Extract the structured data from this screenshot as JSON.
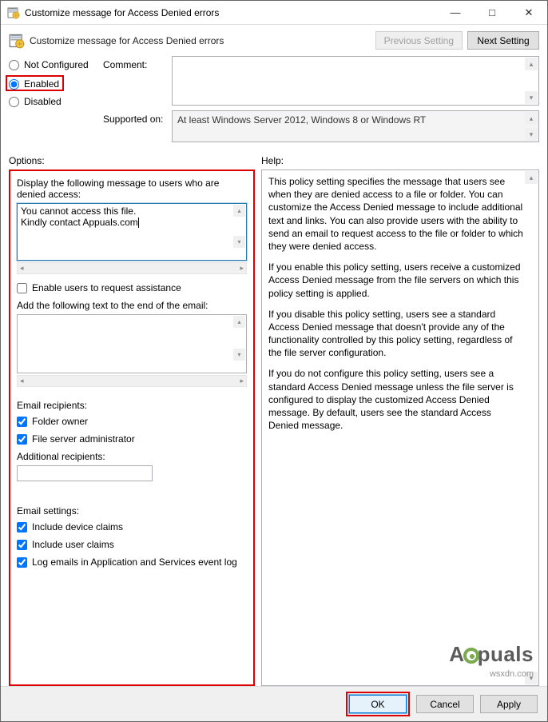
{
  "window": {
    "title": "Customize message for Access Denied errors"
  },
  "header": {
    "title": "Customize message for Access Denied errors",
    "prev_btn": "Previous Setting",
    "next_btn": "Next Setting"
  },
  "state": {
    "not_configured": "Not Configured",
    "enabled": "Enabled",
    "disabled": "Disabled",
    "selected": "enabled"
  },
  "meta": {
    "comment_label": "Comment:",
    "comment_value": "",
    "supported_label": "Supported on:",
    "supported_value": "At least Windows Server 2012, Windows 8 or Windows RT"
  },
  "sections": {
    "options_label": "Options:",
    "help_label": "Help:"
  },
  "options": {
    "display_msg_label": "Display the following message to users who are denied access:",
    "display_msg_value": "You cannot access this file.\nKindly contact Appuals.com",
    "enable_request_label": "Enable users to request assistance",
    "enable_request_checked": false,
    "email_text_label": "Add the following text to the end of the email:",
    "email_text_value": "",
    "recipients_label": "Email recipients:",
    "folder_owner_label": "Folder owner",
    "folder_owner_checked": true,
    "file_admin_label": "File server administrator",
    "file_admin_checked": true,
    "additional_label": "Additional recipients:",
    "additional_value": "",
    "settings_label": "Email settings:",
    "device_claims_label": "Include device claims",
    "device_claims_checked": true,
    "user_claims_label": "Include user claims",
    "user_claims_checked": true,
    "log_emails_label": "Log emails in Application and Services event log",
    "log_emails_checked": true
  },
  "help": {
    "p1": "This policy setting specifies the message that users see when they are denied access to a file or folder. You can customize the Access Denied message to include additional text and links. You can also provide users with the ability to send an email to request access to the file or folder to which they were denied access.",
    "p2": "If you enable this policy setting, users receive a customized Access Denied message from the file servers on which this policy setting is applied.",
    "p3": "If you disable this policy setting, users see a standard Access Denied message that doesn't provide any of the functionality controlled by this policy setting, regardless of the file server configuration.",
    "p4": "If you do not configure this policy setting, users see a standard Access Denied message unless the file server is configured to display the customized Access Denied message. By default, users see the standard Access Denied message."
  },
  "footer": {
    "ok": "OK",
    "cancel": "Cancel",
    "apply": "Apply"
  },
  "watermark": {
    "brand_pre": "A",
    "brand_post": "puals",
    "site": "wsxdn.com"
  }
}
